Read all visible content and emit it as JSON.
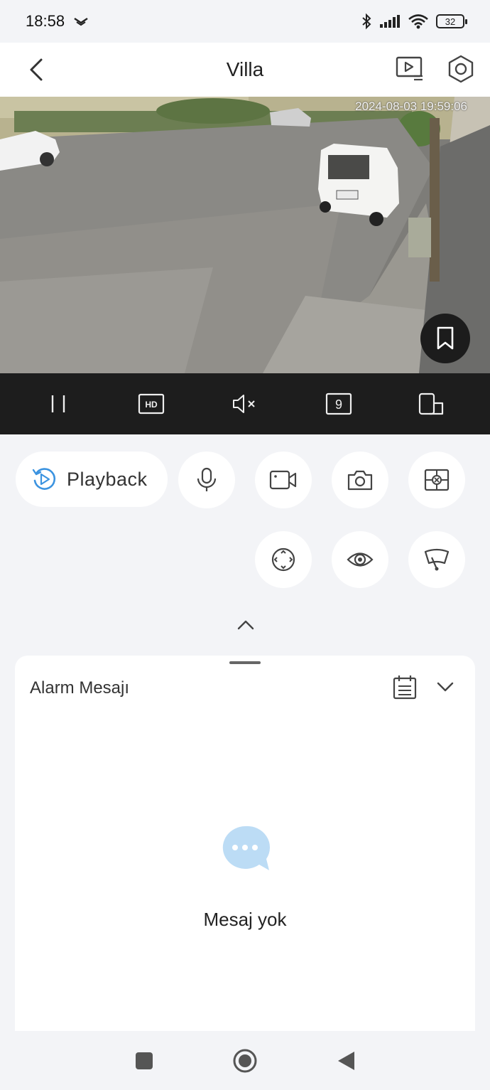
{
  "status_bar": {
    "time": "18:58",
    "battery": "32",
    "icons": [
      "notification-icon",
      "bluetooth-icon",
      "signal-icon",
      "wifi-icon",
      "battery-icon"
    ]
  },
  "header": {
    "title": "Villa",
    "back_icon": "chevron-left-icon",
    "actions": [
      "playlist-icon",
      "settings-hexagon-icon"
    ]
  },
  "video": {
    "timestamp": "2024-08-03 19:59:06",
    "bookmark_icon": "bookmark-icon"
  },
  "player_controls": {
    "hd_label": "HD",
    "split_label": "9",
    "icons": [
      "pause-icon",
      "hd-icon",
      "mute-icon",
      "split-screen-icon",
      "rotate-screen-icon"
    ]
  },
  "actions": {
    "playback_label": "Playback",
    "row1_icons": [
      "microphone-icon",
      "record-video-icon",
      "camera-icon",
      "smart-detect-icon"
    ],
    "row2_icons": [
      "ptz-icon",
      "eye-icon",
      "wiper-icon"
    ],
    "collapse_icon": "chevron-up-icon"
  },
  "alarm": {
    "title": "Alarm Mesajı",
    "empty_text": "Mesaj yok",
    "accent_color": "#bcdcf5"
  },
  "colors": {
    "accent": "#3b93e0",
    "background": "#f3f4f7",
    "player_bar": "#1d1d1d"
  }
}
